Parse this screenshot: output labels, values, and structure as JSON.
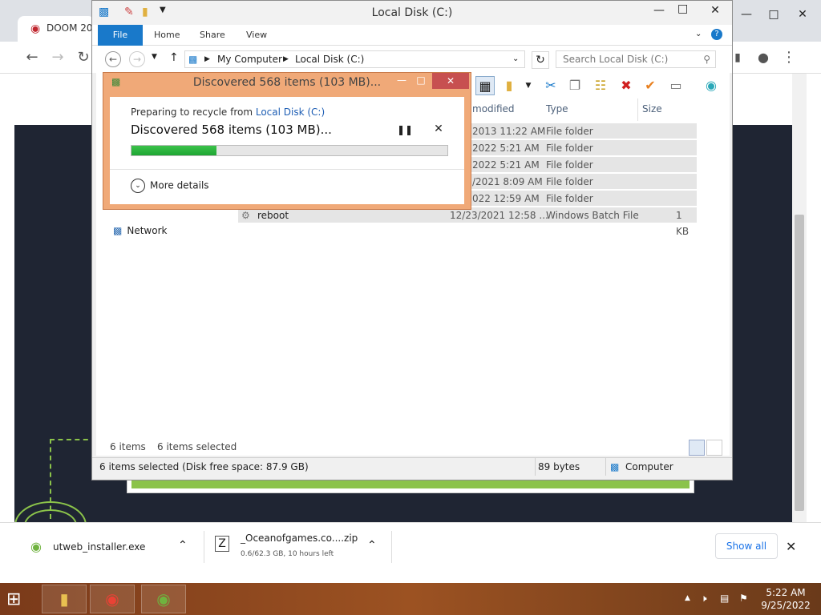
{
  "browser": {
    "tab_title": "DOOM 20",
    "download_shelf": {
      "items": [
        {
          "name": "utweb_installer.exe",
          "status": ""
        },
        {
          "name": "_Oceanofgames.co....zip",
          "status": "0.6/62.3 GB, 10 hours left"
        }
      ],
      "show_all": "Show all"
    }
  },
  "explorer": {
    "title": "Local Disk (C:)",
    "ribbon_tabs": [
      "File",
      "Home",
      "Share",
      "View"
    ],
    "address": {
      "root": "My Computer",
      "current": "Local Disk (C:)"
    },
    "search_placeholder": "Search Local Disk (C:)",
    "columns": {
      "modified": "modified",
      "type": "Type",
      "size": "Size"
    },
    "rows": [
      {
        "name": "",
        "modified": "2013 11:22 AM",
        "type": "File folder",
        "size": ""
      },
      {
        "name": "",
        "modified": "2022 5:21 AM",
        "type": "File folder",
        "size": ""
      },
      {
        "name": "",
        "modified": "2022 5:21 AM",
        "type": "File folder",
        "size": ""
      },
      {
        "name": "",
        "modified": "/2021 8:09 AM",
        "type": "File folder",
        "size": ""
      },
      {
        "name": "",
        "modified": "022 12:59 AM",
        "type": "File folder",
        "size": ""
      },
      {
        "name": "reboot",
        "modified": "12/23/2021 12:58 ...",
        "type": "Windows Batch File",
        "size": "1 KB"
      }
    ],
    "nav": {
      "network": "Network"
    },
    "footer": {
      "items": "6 items",
      "selected": "6 items selected"
    },
    "status": {
      "left": "6 items selected (Disk free space: 87.9 GB)",
      "size": "89 bytes",
      "location": "Computer"
    }
  },
  "dialog": {
    "title": "Discovered 568 items (103 MB)...",
    "sub_prefix": "Preparing to recycle from ",
    "sub_link": "Local Disk (C:)",
    "main": "Discovered 568 items (103 MB)...",
    "progress": 0.27,
    "more_details": "More details"
  },
  "taskbar": {
    "time": "5:22 AM",
    "date": "9/25/2022"
  },
  "colors": {
    "dialog_frame": "#f0a978",
    "dialog_close": "#c75050",
    "progress_fill": "#1ea533",
    "file_tab": "#1979ca",
    "page_bg": "#1f2533",
    "accent_green": "#8bc34a"
  }
}
